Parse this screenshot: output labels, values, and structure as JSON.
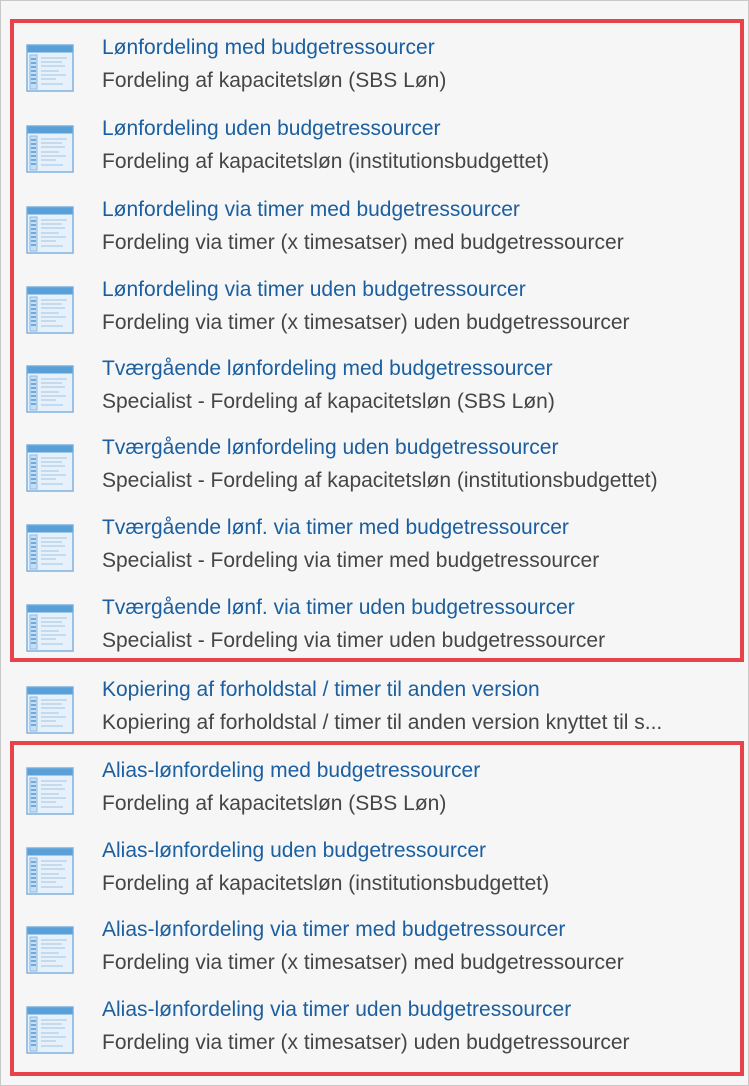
{
  "items": [
    {
      "title": "Lønfordeling med budgetressourcer",
      "subtitle": "Fordeling af kapacitetsløn (SBS Løn)",
      "icon": "report-icon"
    },
    {
      "title": "Lønfordeling uden budgetressourcer",
      "subtitle": "Fordeling af kapacitetsløn (institutionsbudgettet)",
      "icon": "report-icon"
    },
    {
      "title": "Lønfordeling via timer med budgetressourcer",
      "subtitle": "Fordeling via timer (x timesatser) med budgetressourcer",
      "icon": "report-icon"
    },
    {
      "title": "Lønfordeling via timer uden budgetressourcer",
      "subtitle": "Fordeling via timer (x timesatser) uden budgetressourcer",
      "icon": "report-icon"
    },
    {
      "title": "Tværgående lønfordeling med budgetressourcer",
      "subtitle": "Specialist - Fordeling af kapacitetsløn (SBS Løn)",
      "icon": "report-icon"
    },
    {
      "title": "Tværgående lønfordeling uden budgetressourcer",
      "subtitle": "Specialist - Fordeling af kapacitetsløn (institutionsbudgettet)",
      "icon": "report-icon"
    },
    {
      "title": "Tværgående lønf. via timer med budgetressourcer",
      "subtitle": "Specialist - Fordeling via timer med budgetressourcer",
      "icon": "report-icon"
    },
    {
      "title": "Tværgående lønf. via timer uden budgetressourcer",
      "subtitle": "Specialist - Fordeling via timer uden budgetressourcer",
      "icon": "report-icon"
    },
    {
      "title": "Kopiering af forholdstal / timer til anden version",
      "subtitle": "Kopiering af forholdstal / timer til anden version knyttet til s...",
      "icon": "report-icon"
    },
    {
      "title": "Alias-lønfordeling med budgetressourcer",
      "subtitle": "Fordeling af kapacitetsløn (SBS Løn)",
      "icon": "report-icon"
    },
    {
      "title": "Alias-lønfordeling uden budgetressourcer",
      "subtitle": "Fordeling af kapacitetsløn (institutionsbudgettet)",
      "icon": "report-icon"
    },
    {
      "title": "Alias-lønfordeling via timer med budgetressourcer",
      "subtitle": "Fordeling via timer (x timesatser) med budgetressourcer",
      "icon": "report-icon"
    },
    {
      "title": "Alias-lønfordeling via timer uden budgetressourcer",
      "subtitle": "Fordeling via timer (x timesatser) uden budgetressourcer",
      "icon": "report-icon"
    }
  ],
  "colors": {
    "title": "#1b5fa0",
    "subtitle": "#454545",
    "highlight": "#e8434a",
    "background": "#f6f6f6"
  }
}
